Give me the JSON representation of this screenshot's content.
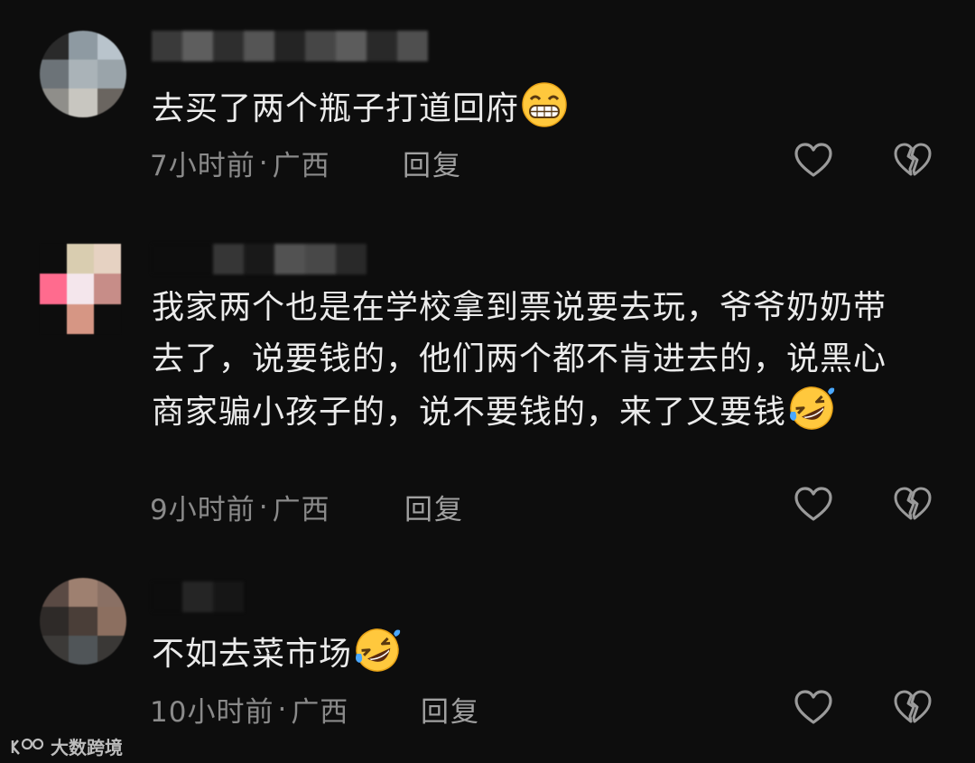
{
  "comments": [
    {
      "text": "去买了两个瓶子打道回府",
      "emoji": "grinning-face-emoji",
      "time": "7小时前",
      "location": "广西",
      "reply_label": "回复"
    },
    {
      "text": "我家两个也是在学校拿到票说要去玩，爷爷奶奶带去了，说要钱的，他们两个都不肯进去的，说黑心商家骗小孩子的，说不要钱的，来了又要钱",
      "emoji": "rolling-on-floor-laughing-emoji",
      "time": "9小时前",
      "location": "广西",
      "reply_label": "回复"
    },
    {
      "text": "不如去菜市场",
      "emoji": "rolling-on-floor-laughing-emoji",
      "time": "10小时前",
      "location": "广西",
      "reply_label": "回复"
    }
  ],
  "meta_separator": "·",
  "watermark": "大数跨境",
  "icons": {
    "like": "heart-outline-icon",
    "dislike": "broken-heart-icon"
  },
  "colors": {
    "background": "#0d0d0d",
    "text": "#ebebeb",
    "meta": "#8a8a8a",
    "emoji_yellow": "#ffc83d"
  }
}
